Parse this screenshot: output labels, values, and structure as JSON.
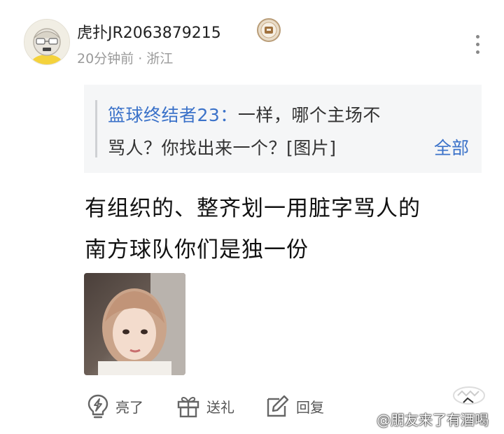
{
  "comment": {
    "username": "虎扑JR2063879215",
    "meta": "20分钟前 · 浙江",
    "quote": {
      "author": "篮球终结者23：",
      "line1_text": "一样，哪个主场不",
      "line2_text": "骂人？你找出来一个？[图片]",
      "more_label": "全部"
    },
    "content_line1": "有组织的、整齐划一用脏字骂人的",
    "content_line2": "南方球队你们是独一份",
    "actions": {
      "like_label": "亮了",
      "gift_label": "送礼",
      "reply_label": "回复"
    }
  },
  "watermark": "@朋友来了有酒喝",
  "icons": {
    "avatar": "cartoon-avatar",
    "badge": "level-badge-icon",
    "more": "more-vertical-icon",
    "like": "lightning-bulb-icon",
    "gift": "gift-icon",
    "reply": "edit-icon"
  },
  "colors": {
    "link": "#3b72c9",
    "meta": "#9a9a9a",
    "quote_bg": "#f5f6f7"
  }
}
